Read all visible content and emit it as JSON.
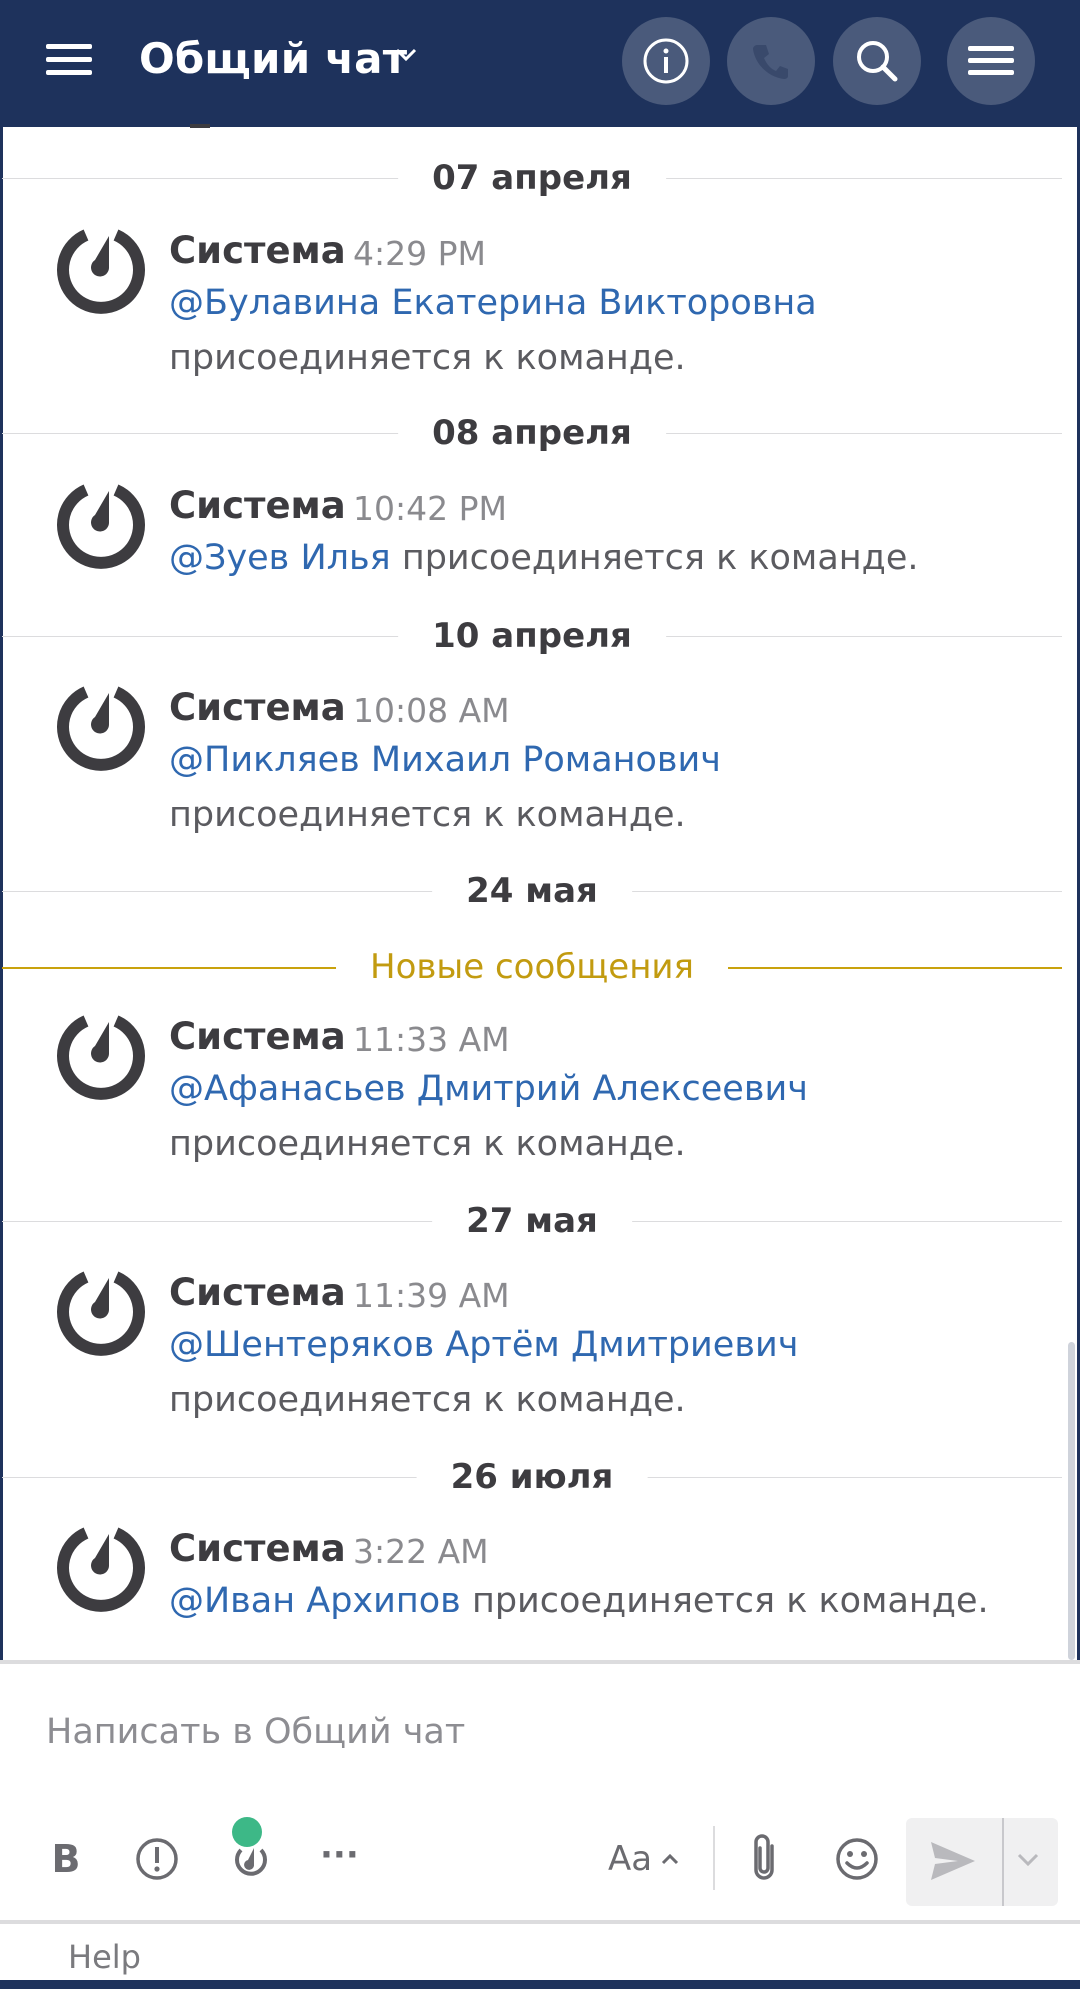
{
  "header": {
    "title": "Общий чат",
    "buttons": [
      "info-icon",
      "phone-icon",
      "search-icon",
      "menu-icon"
    ]
  },
  "separators": [
    {
      "label": "07 апреля"
    },
    {
      "label": "08 апреля"
    },
    {
      "label": "10 апреля"
    },
    {
      "label": "24 мая"
    },
    {
      "label": "Новые сообщения"
    },
    {
      "label": "27 мая"
    },
    {
      "label": "26 июля"
    }
  ],
  "posts": [
    {
      "author": "Система",
      "time": "4:29 PM",
      "mention": "@Булавина Екатерина Викторовна",
      "text": "присоединяется к команде."
    },
    {
      "author": "Система",
      "time": "10:42 PM",
      "mention": "@Зуев Илья",
      "text": "присоединяется к команде."
    },
    {
      "author": "Система",
      "time": "10:08 AM",
      "mention": "@Пикляев Михаил Романович",
      "text": "присоединяется к команде."
    },
    {
      "author": "Система",
      "time": "11:33 AM",
      "mention": "@Афанасьев Дмитрий Алексеевич",
      "text": "присоединяется к команде."
    },
    {
      "author": "Система",
      "time": "11:39 AM",
      "mention": "@Шентеряков Артём Дмитриевич",
      "text": "присоединяется к команде."
    },
    {
      "author": "Система",
      "time": "3:22 AM",
      "mention": "@Иван Архипов",
      "text": "присоединяется к команде."
    }
  ],
  "composer": {
    "placeholder": "Написать в Общий чат",
    "bold_label": "B",
    "more_label": "···",
    "format_label": "Aa"
  },
  "footer": {
    "help": "Help"
  },
  "colors": {
    "header": "#1e325c",
    "mention": "#2f68b0",
    "new_messages": "#c29b10",
    "online": "#3db887"
  }
}
